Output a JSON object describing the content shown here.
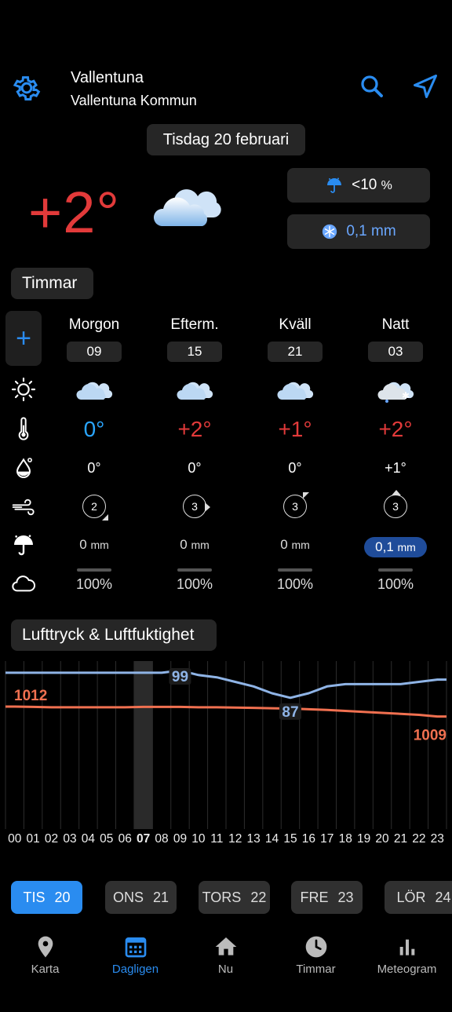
{
  "header": {
    "city": "Vallentuna",
    "municipality": "Vallentuna Kommun"
  },
  "date": "Tisdag 20 februari",
  "current": {
    "temperature": "+2°",
    "precip_probability": "<10",
    "precip_probability_unit": "%",
    "precip_amount": "0,1 mm"
  },
  "hours_section": {
    "title": "Timmar",
    "plus_label": "+",
    "periods": [
      {
        "name": "Morgon",
        "hour": "09",
        "temp": "0°",
        "temp_color": "#2aa6ff",
        "feels": "0°",
        "wind": "2",
        "rain": "0",
        "rain_unit": "mm",
        "clouds": "100%"
      },
      {
        "name": "Efterm.",
        "hour": "15",
        "temp": "+2°",
        "temp_color": "#e23a3a",
        "feels": "0°",
        "wind": "3",
        "rain": "0",
        "rain_unit": "mm",
        "clouds": "100%"
      },
      {
        "name": "Kväll",
        "hour": "21",
        "temp": "+1°",
        "temp_color": "#e23a3a",
        "feels": "0°",
        "wind": "3",
        "rain": "0",
        "rain_unit": "mm",
        "clouds": "100%"
      },
      {
        "name": "Natt",
        "hour": "03",
        "temp": "+2°",
        "temp_color": "#e23a3a",
        "feels": "+1°",
        "wind": "3",
        "rain": "0,1",
        "rain_unit": "mm",
        "clouds": "100%"
      }
    ]
  },
  "pressure_section": {
    "title": "Lufttryck & Luftfuktighet"
  },
  "chart_data": {
    "type": "line",
    "x": [
      "00",
      "01",
      "02",
      "03",
      "04",
      "05",
      "06",
      "07",
      "08",
      "09",
      "10",
      "11",
      "12",
      "13",
      "14",
      "15",
      "16",
      "17",
      "18",
      "19",
      "20",
      "21",
      "22",
      "23"
    ],
    "highlight_hour": "07",
    "series": [
      {
        "name": "",
        "color": "#8fb4e6",
        "values": [
          98,
          98,
          98,
          98,
          98,
          98,
          98,
          98,
          98,
          99,
          97,
          96,
          94,
          92,
          89,
          87,
          89,
          92,
          93,
          93,
          93,
          93,
          94,
          95
        ]
      },
      {
        "name": "",
        "color": "#f07050",
        "values": [
          1012,
          1011.9,
          1011.8,
          1011.8,
          1011.8,
          1011.8,
          1011.8,
          1011.9,
          1011.9,
          1011.9,
          1011.8,
          1011.8,
          1011.7,
          1011.6,
          1011.5,
          1011.4,
          1011.2,
          1011,
          1010.7,
          1010.4,
          1010.1,
          1009.8,
          1009.5,
          1009
        ]
      }
    ],
    "labels": [
      {
        "text": "99",
        "hour": 9,
        "series": 0
      },
      {
        "text": "87",
        "hour": 15,
        "series": 0
      },
      {
        "text": "1012",
        "hour": 0,
        "series": 1
      },
      {
        "text": "1009",
        "hour": 23,
        "series": 1
      }
    ]
  },
  "days": [
    {
      "name": "TIS",
      "num": "20",
      "active": true
    },
    {
      "name": "ONS",
      "num": "21",
      "active": false
    },
    {
      "name": "TORS",
      "num": "22",
      "active": false
    },
    {
      "name": "FRE",
      "num": "23",
      "active": false
    },
    {
      "name": "LÖR",
      "num": "24",
      "active": false
    }
  ],
  "nav": [
    {
      "label": "Karta",
      "icon": "map-pin-icon",
      "active": false
    },
    {
      "label": "Dagligen",
      "icon": "calendar-icon",
      "active": true
    },
    {
      "label": "Nu",
      "icon": "home-icon",
      "active": false
    },
    {
      "label": "Timmar",
      "icon": "clock-icon",
      "active": false
    },
    {
      "label": "Meteogram",
      "icon": "bar-chart-icon",
      "active": false
    }
  ]
}
